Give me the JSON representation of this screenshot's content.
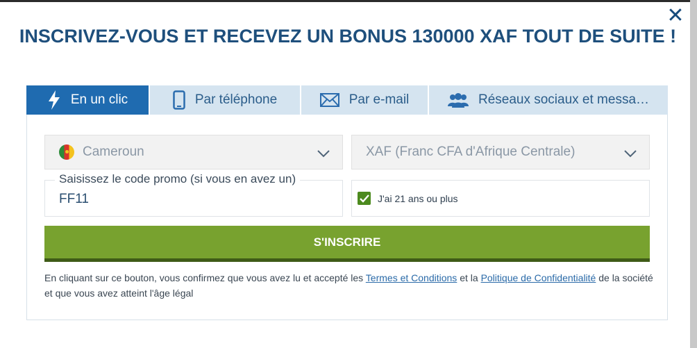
{
  "modal": {
    "title": "INSCRIVEZ-VOUS ET RECEVEZ UN BONUS 130000 XAF TOUT DE SUITE !",
    "close_label": "✕"
  },
  "tabs": [
    {
      "label": "En un clic",
      "icon": "lightning-icon",
      "active": true
    },
    {
      "label": "Par téléphone",
      "icon": "phone-icon",
      "active": false
    },
    {
      "label": "Par e-mail",
      "icon": "envelope-icon",
      "active": false
    },
    {
      "label": "Réseaux sociaux et messa…",
      "icon": "users-icon",
      "active": false
    }
  ],
  "form": {
    "country": "Cameroun",
    "currency": "XAF (Franc CFA d'Afrique Centrale)",
    "promo_label": "Saisissez le code promo (si vous en avez un)",
    "promo_value": "FF11",
    "age_checked": true,
    "age_label": "J'ai 21 ans ou plus",
    "submit_label": "S'INSCRIRE"
  },
  "legal": {
    "part1": "En cliquant sur ce bouton, vous confirmez que vous avez lu et accepté les ",
    "terms_link": "Termes et Conditions",
    "part2": " et la ",
    "privacy_link": "Politique de Confidentialité",
    "part3": " de la société et que vous avez atteint l'âge légal"
  },
  "colors": {
    "title": "#1e4f7c",
    "active_tab": "#1f6bb0",
    "inactive_tab": "#d5e4f0",
    "submit": "#78a22f",
    "checkbox": "#4c8a1e"
  }
}
